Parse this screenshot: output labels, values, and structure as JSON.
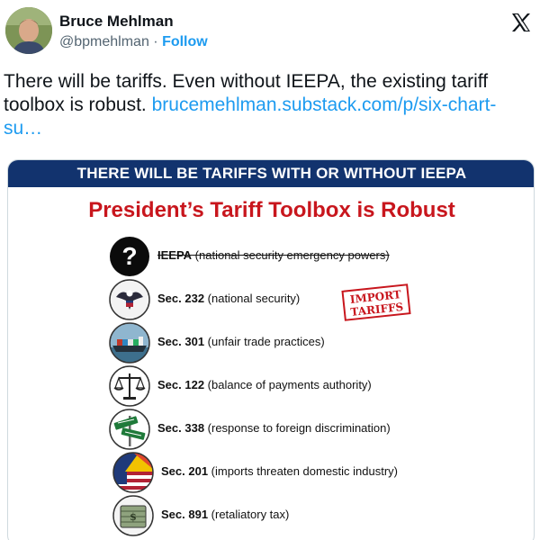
{
  "author": {
    "name": "Bruce Mehlman",
    "handle": "@bpmehlman",
    "separator": " · ",
    "follow_label": "Follow",
    "avatar_icon": "profile-photo",
    "platform_icon": "x-logo-icon"
  },
  "tweet": {
    "text": "There will be tariffs.  Even without IEEPA, the existing tariff toolbox is robust. ",
    "link": "brucemehlman.substack.com/p/six-chart-su…"
  },
  "card": {
    "banner": "THERE WILL BE TARIFFS WITH OR WITHOUT IEEPA",
    "title": "President’s Tariff Toolbox is Robust",
    "stamp": {
      "line1": "IMPORT",
      "line2": "TARIFFS"
    },
    "items": [
      {
        "code": "IEEPA",
        "desc": " (national security emergency powers)",
        "icon": "question-mark-icon",
        "struck": true
      },
      {
        "code": "Sec. 232",
        "desc": " (national security)",
        "icon": "eagle-seal-icon",
        "struck": false
      },
      {
        "code": "Sec. 301",
        "desc": " (unfair trade practices)",
        "icon": "container-ship-icon",
        "struck": false
      },
      {
        "code": "Sec. 122",
        "desc": " (balance of payments authority)",
        "icon": "balance-scale-icon",
        "struck": false
      },
      {
        "code": "Sec. 338",
        "desc": " (response to foreign discrimination)",
        "icon": "street-sign-icon",
        "struck": false
      },
      {
        "code": "Sec. 201",
        "desc": " (imports threaten domestic industry)",
        "icon": "flag-globe-icon",
        "struck": false
      },
      {
        "code": "Sec. 891",
        "desc": " (retaliatory tax)",
        "icon": "money-stack-icon",
        "struck": false
      }
    ]
  }
}
